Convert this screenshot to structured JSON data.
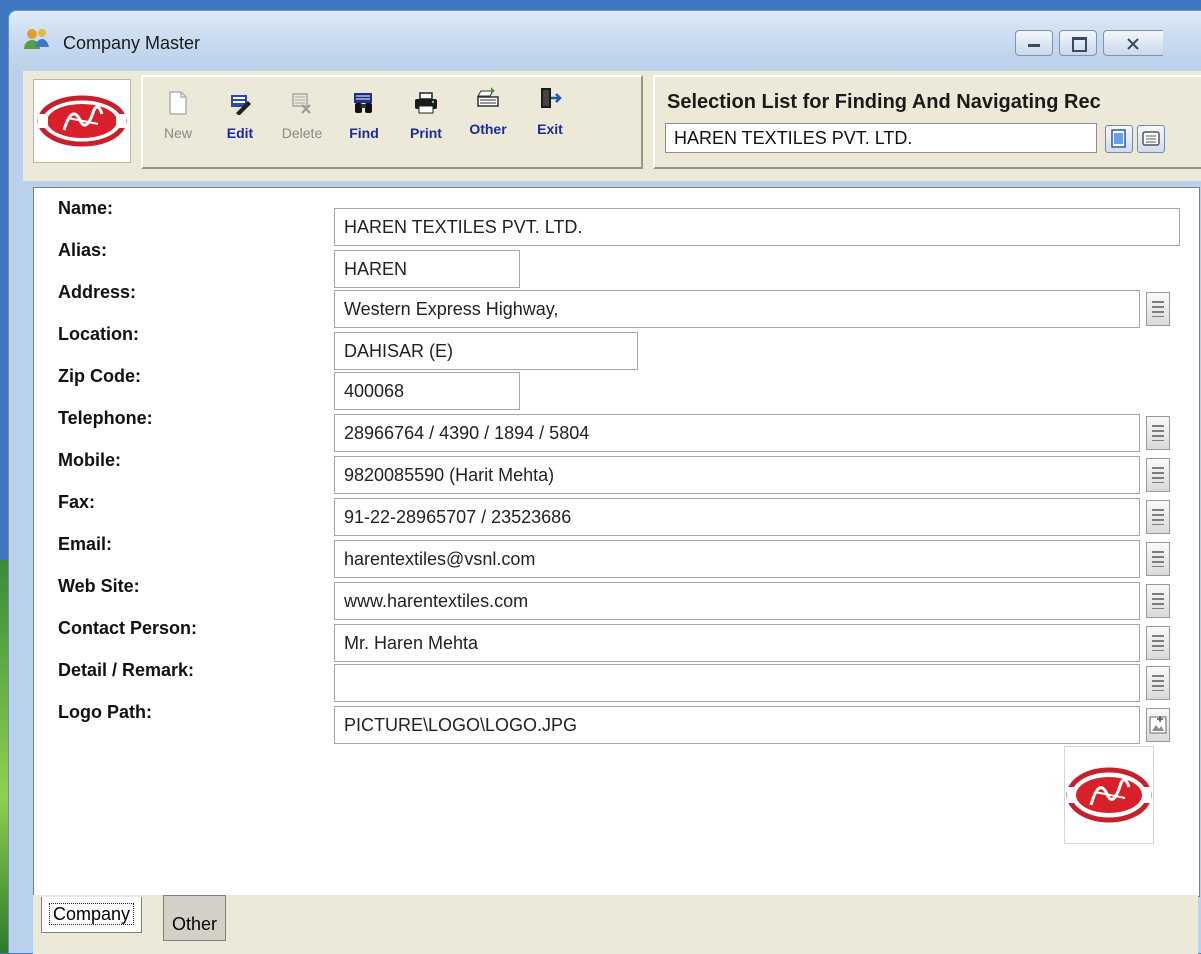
{
  "window": {
    "title": "Company Master",
    "icon": "users-icon"
  },
  "toolbar": {
    "buttons": [
      {
        "label": "New",
        "icon": "new-document-icon",
        "state": "disabled"
      },
      {
        "label": "Edit",
        "icon": "edit-icon",
        "state": "enabled"
      },
      {
        "label": "Delete",
        "icon": "delete-icon",
        "state": "disabled"
      },
      {
        "label": "Find",
        "icon": "binoculars-icon",
        "state": "enabled"
      },
      {
        "label": "Print",
        "icon": "printer-icon",
        "state": "enabled"
      },
      {
        "label": "Other",
        "icon": "other-icon",
        "state": "enabled"
      },
      {
        "label": "Exit",
        "icon": "exit-door-icon",
        "state": "enabled"
      }
    ]
  },
  "navigation": {
    "title": "Selection List for Finding And Navigating Rec",
    "value": "HAREN TEXTILES PVT. LTD."
  },
  "form": {
    "fields": [
      {
        "label": "Name:",
        "value": "HAREN TEXTILES PVT. LTD."
      },
      {
        "label": "Alias:",
        "value": "HAREN"
      },
      {
        "label": "Address:",
        "value": "Western Express Highway,"
      },
      {
        "label": "Location:",
        "value": "DAHISAR (E)"
      },
      {
        "label": "Zip Code:",
        "value": "400068"
      },
      {
        "label": "Telephone:",
        "value": "28966764 / 4390 / 1894 / 5804"
      },
      {
        "label": "Mobile:",
        "value": "9820085590 (Harit Mehta)"
      },
      {
        "label": "Fax:",
        "value": "91-22-28965707 / 23523686"
      },
      {
        "label": "Email:",
        "value": "harentextiles@vsnl.com"
      },
      {
        "label": "Web Site:",
        "value": "www.harentextiles.com"
      },
      {
        "label": "Contact Person:",
        "value": "Mr. Haren Mehta"
      },
      {
        "label": "Detail / Remark:",
        "value": ""
      },
      {
        "label": "Logo Path:",
        "value": "PICTURE\\LOGO\\LOGO.JPG"
      }
    ]
  },
  "tabs": [
    {
      "label": "Company",
      "active": true
    },
    {
      "label": "Other",
      "active": false
    }
  ],
  "colors": {
    "accent_text": "#1a2b9a",
    "logo_red": "#d8202a",
    "panel_bg": "#ece9d8",
    "title_bg": "#c6d9ef"
  }
}
